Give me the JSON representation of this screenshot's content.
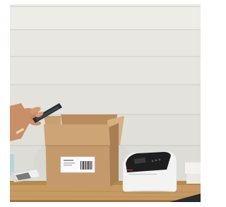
{
  "scene": {
    "kind": "photograph",
    "subjects": [
      "hand-holding-smartphone",
      "open-cardboard-box",
      "shipping-label",
      "label-printer",
      "wooden-shelf",
      "shiplap-wall"
    ],
    "colors": {
      "wall": "#e9e8e3",
      "wall_shadow": "#dddcd6",
      "board_line": "#cfcdc6",
      "cardboard": "#c49a6c",
      "cardboard_dark": "#a87f55",
      "cardboard_light": "#d6b183",
      "wood_shelf": "#c79a63",
      "wood_shelf_dark": "#9c7244",
      "printer_white": "#f3f3f2",
      "printer_black": "#1e1e20",
      "skin": "#c98f68",
      "phone": "#2b2b2e",
      "label_paper": "#fafafa"
    },
    "shipping_label_text": ""
  }
}
